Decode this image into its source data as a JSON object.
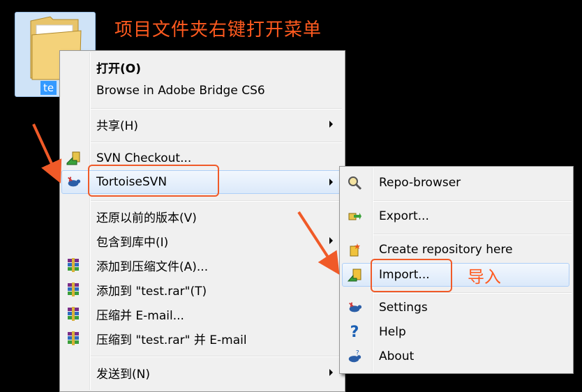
{
  "annotation": {
    "title": "项目文件夹右键打开菜单",
    "import_note": "导入"
  },
  "desktop": {
    "folder_label": "te"
  },
  "context_menu": {
    "items": [
      {
        "label": "打开(O)",
        "bold": true,
        "icon": ""
      },
      {
        "label": "Browse in Adobe Bridge CS6",
        "icon": ""
      },
      {
        "label": "共享(H)",
        "submenu": true,
        "icon": ""
      },
      {
        "label": "SVN Checkout...",
        "icon": "svn-checkout-icon"
      },
      {
        "label": "TortoiseSVN",
        "submenu": true,
        "icon": "tortoisesvn-icon",
        "highlighted": true
      },
      {
        "label": "还原以前的版本(V)",
        "icon": ""
      },
      {
        "label": "包含到库中(I)",
        "submenu": true,
        "icon": ""
      },
      {
        "label": "添加到压缩文件(A)...",
        "icon": "winrar-icon"
      },
      {
        "label": "添加到 \"test.rar\"(T)",
        "icon": "winrar-icon"
      },
      {
        "label": "压缩并 E-mail...",
        "icon": "winrar-icon"
      },
      {
        "label": "压缩到 \"test.rar\" 并 E-mail",
        "icon": "winrar-icon"
      },
      {
        "label": "发送到(N)",
        "submenu": true,
        "icon": ""
      }
    ]
  },
  "submenu": {
    "items": [
      {
        "label": "Repo-browser",
        "icon": "repo-browser-icon"
      },
      {
        "label": "Export...",
        "icon": "export-icon"
      },
      {
        "label": "Create repository here",
        "icon": "create-repository-icon"
      },
      {
        "label": "Import...",
        "icon": "import-icon",
        "highlighted": true
      },
      {
        "label": "Settings",
        "icon": "settings-icon"
      },
      {
        "label": "Help",
        "icon": "help-icon"
      },
      {
        "label": "About",
        "icon": "about-icon"
      }
    ]
  },
  "colors": {
    "annotation": "#ff5a1f",
    "highlight_border": "#f05a28",
    "menu_bg": "#f0f0f0"
  }
}
